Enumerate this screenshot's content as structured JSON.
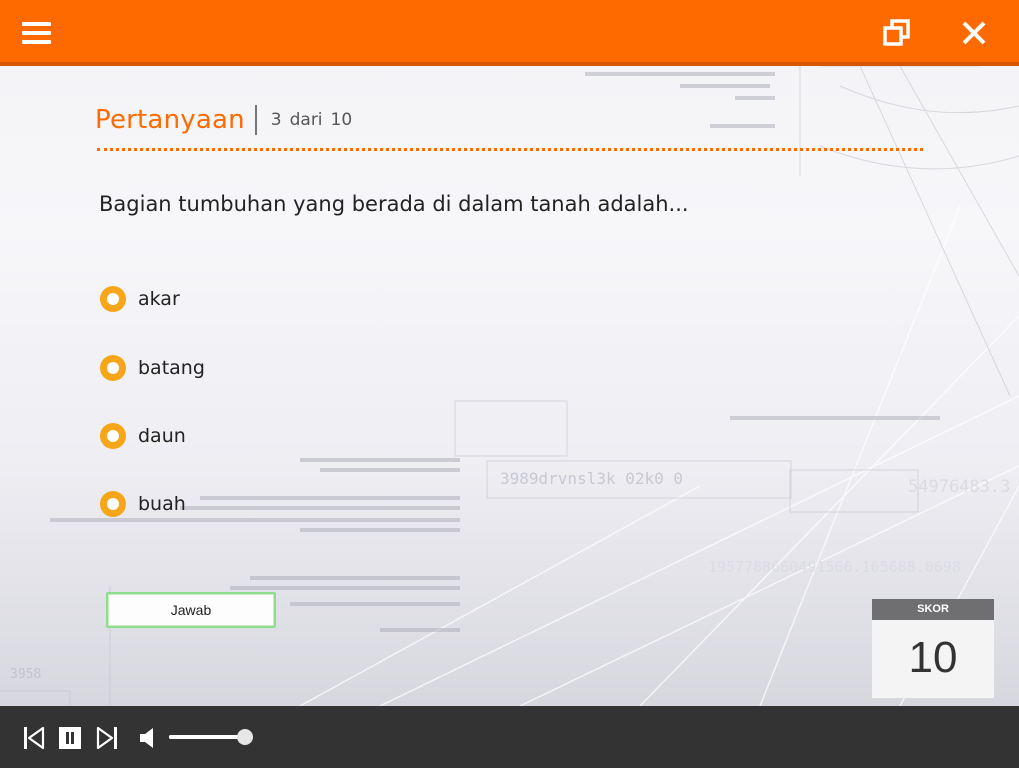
{
  "window": {
    "menu_icon": "hamburger-menu-icon",
    "restore_icon": "restore-window-icon",
    "close_icon": "close-icon",
    "accent_color": "#ff6a00"
  },
  "quiz": {
    "title": "Pertanyaan",
    "current": "3",
    "of_word": "dari",
    "total": "10",
    "question": "Bagian tumbuhan yang berada di dalam tanah adalah...",
    "options": [
      {
        "label": "akar"
      },
      {
        "label": "batang"
      },
      {
        "label": "daun"
      },
      {
        "label": "buah"
      }
    ],
    "submit_label": "Jawab"
  },
  "score": {
    "label": "SKOR",
    "value": "10"
  },
  "player": {
    "prev_icon": "skip-previous-icon",
    "pause_icon": "pause-icon",
    "next_icon": "skip-next-icon",
    "volume_icon": "volume-icon",
    "volume_level": 1.0
  },
  "background_text": {
    "line1": "3989drvnsl3k   02k0   0",
    "line2": "54976483.3",
    "line3": "1957788660491566.165688.0698",
    "line4": "3958"
  }
}
